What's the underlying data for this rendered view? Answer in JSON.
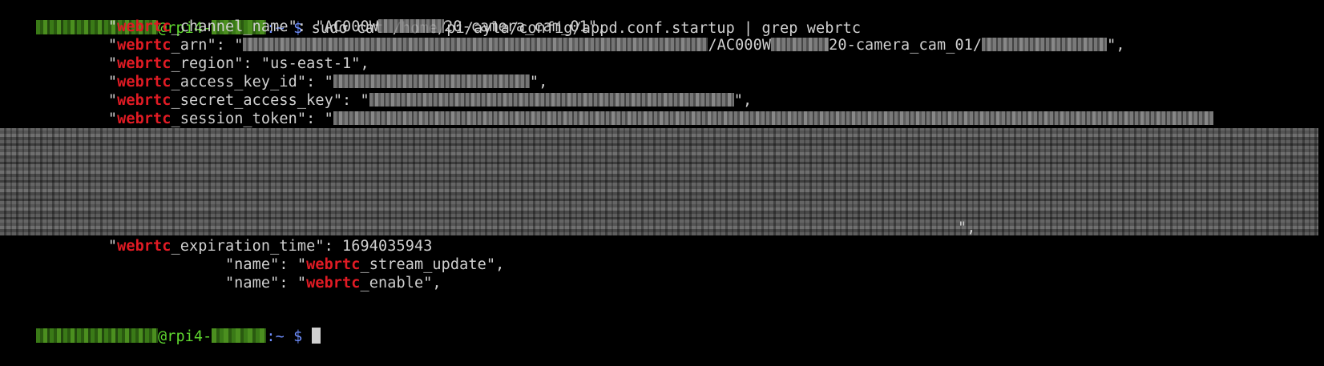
{
  "prompt": {
    "user_host_separator": "@",
    "host": "rpi4-",
    "path": ":~",
    "symbol": "$"
  },
  "command": "sudo cat /home/pi/ayla/config/appd.conf.startup | grep webrtc",
  "lines": {
    "channel_name": {
      "indent": "            \"",
      "keyword": "webrtc",
      "rest": "_channel_name\": \"AC000W",
      "tail": "20-camera_cam_01\","
    },
    "arn": {
      "indent": "            \"",
      "keyword": "webrtc",
      "rest": "_arn\": \"",
      "middle": "/AC000W",
      "tail_a": "20-camera_cam_01/",
      "tail_b": "\","
    },
    "region": {
      "indent": "            \"",
      "keyword": "webrtc",
      "rest": "_region\": \"us-east-1\","
    },
    "access_key_id": {
      "indent": "            \"",
      "keyword": "webrtc",
      "rest": "_access_key_id\": \"",
      "tail": "\","
    },
    "secret_access_key": {
      "indent": "            \"",
      "keyword": "webrtc",
      "rest": "_secret_access_key\": \"",
      "tail": "\","
    },
    "session_token": {
      "indent": "            \"",
      "keyword": "webrtc",
      "rest": "_session_token\": \"",
      "tail": "\","
    },
    "expiration_time": {
      "indent": "            \"",
      "keyword": "webrtc",
      "rest": "_expiration_time\": 1694035943"
    },
    "name_stream_update": {
      "indent": "                         \"name\": \"",
      "keyword": "webrtc",
      "rest": "_stream_update\","
    },
    "name_enable": {
      "indent": "                         \"name\": \"",
      "keyword": "webrtc",
      "rest": "_enable\","
    }
  },
  "colors": {
    "background": "#000000",
    "text": "#d0d0d0",
    "prompt_user": "#5fd72f",
    "prompt_path": "#6f8fff",
    "highlight": "#e01b24"
  },
  "icons": {
    "cursor": "block-cursor-icon"
  }
}
